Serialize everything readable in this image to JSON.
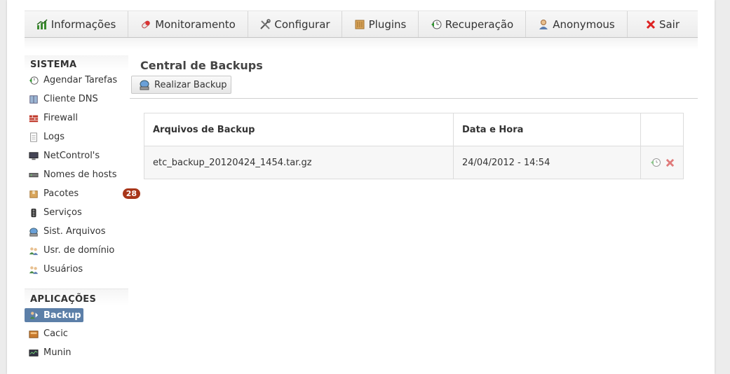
{
  "nav": {
    "items": [
      {
        "label": "Informações",
        "icon": "chart-icon"
      },
      {
        "label": "Monitoramento",
        "icon": "pill-icon"
      },
      {
        "label": "Configurar",
        "icon": "tools-icon"
      },
      {
        "label": "Plugins",
        "icon": "box-icon"
      },
      {
        "label": "Recuperação",
        "icon": "restore-icon"
      },
      {
        "label": "Anonymous",
        "icon": "user-icon"
      },
      {
        "label": "Sair",
        "icon": "close-icon"
      }
    ]
  },
  "sidebar": {
    "system_title": "SISTEMA",
    "system_items": [
      {
        "label": "Agendar Tarefas"
      },
      {
        "label": "Cliente DNS"
      },
      {
        "label": "Firewall"
      },
      {
        "label": "Logs"
      },
      {
        "label": "NetControl's"
      },
      {
        "label": "Nomes de hosts"
      },
      {
        "label": "Pacotes",
        "badge": "28"
      },
      {
        "label": "Serviços"
      },
      {
        "label": "Sist. Arquivos"
      },
      {
        "label": "Usr. de domínio"
      },
      {
        "label": "Usuários"
      }
    ],
    "apps_title": "APLICAÇÕES",
    "app_items": [
      {
        "label": "Backup"
      },
      {
        "label": "Cacic"
      },
      {
        "label": "Munin"
      }
    ]
  },
  "main": {
    "title": "Central de Backups",
    "button_label": "Realizar Backup",
    "table": {
      "headers": [
        "Arquivos de Backup",
        "Data e Hora",
        ""
      ],
      "rows": [
        {
          "file": "etc_backup_20120424_1454.tar.gz",
          "datetime": "24/04/2012 - 14:54"
        }
      ]
    }
  },
  "colors": {
    "active_item_bg": "#5c7fa8",
    "badge_bg": "#a8361a",
    "delete_red": "#d9534f"
  }
}
